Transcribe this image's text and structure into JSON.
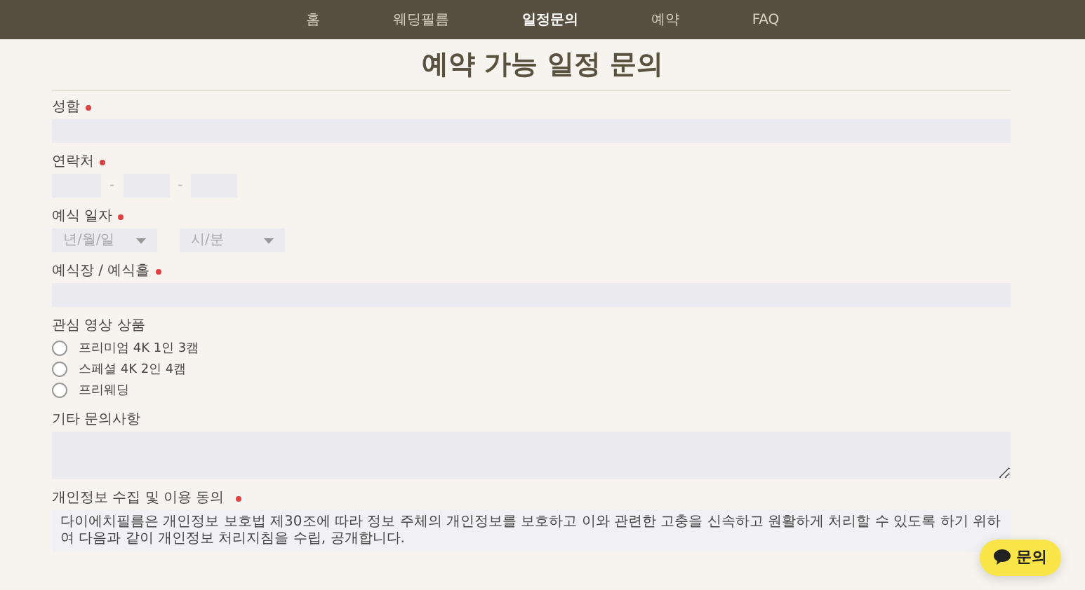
{
  "nav": {
    "items": [
      {
        "label": "홈",
        "selected": false
      },
      {
        "label": "웨딩필름",
        "selected": false
      },
      {
        "label": "일정문의",
        "selected": true
      },
      {
        "label": "예약",
        "selected": false
      },
      {
        "label": "FAQ",
        "selected": false
      }
    ]
  },
  "title": "예약 가능 일정 문의",
  "fields": [
    {
      "kind": "text",
      "label": "성함",
      "required": true
    },
    {
      "kind": "phone",
      "label": "연락처",
      "required": true,
      "separators": [
        "-",
        "-"
      ]
    },
    {
      "kind": "datetime",
      "label": "예식 일자",
      "required": true,
      "selects": [
        {
          "placeholder": "년/월/일"
        },
        {
          "placeholder": "시/분"
        }
      ]
    },
    {
      "kind": "text",
      "label": "예식장 / 예식홀",
      "required": true
    },
    {
      "kind": "radio",
      "label": "관심 영상 상품",
      "required": false,
      "options": [
        {
          "label": "프리미엄 4K 1인 3캠",
          "selected": false
        },
        {
          "label": "스페셜 4K 2인 4캠",
          "selected": false
        },
        {
          "label": "프리웨딩",
          "selected": false
        }
      ]
    },
    {
      "kind": "textarea",
      "label": "기타 문의사항",
      "required": false
    },
    {
      "kind": "consent",
      "label": "개인정보 수집 및 이용 동의",
      "required": true,
      "text": "다이에치필름은 개인정보 보호법 제30조에 따라 정보 주체의 개인정보를 보호하고 이와 관련한 고충을 신속하고 원활하게 처리할 수 있도록 하기 위하여 다음과 같이 개인정보 처리지침을 수립, 공개합니다."
    }
  ],
  "chat_button": {
    "label": "문의"
  }
}
